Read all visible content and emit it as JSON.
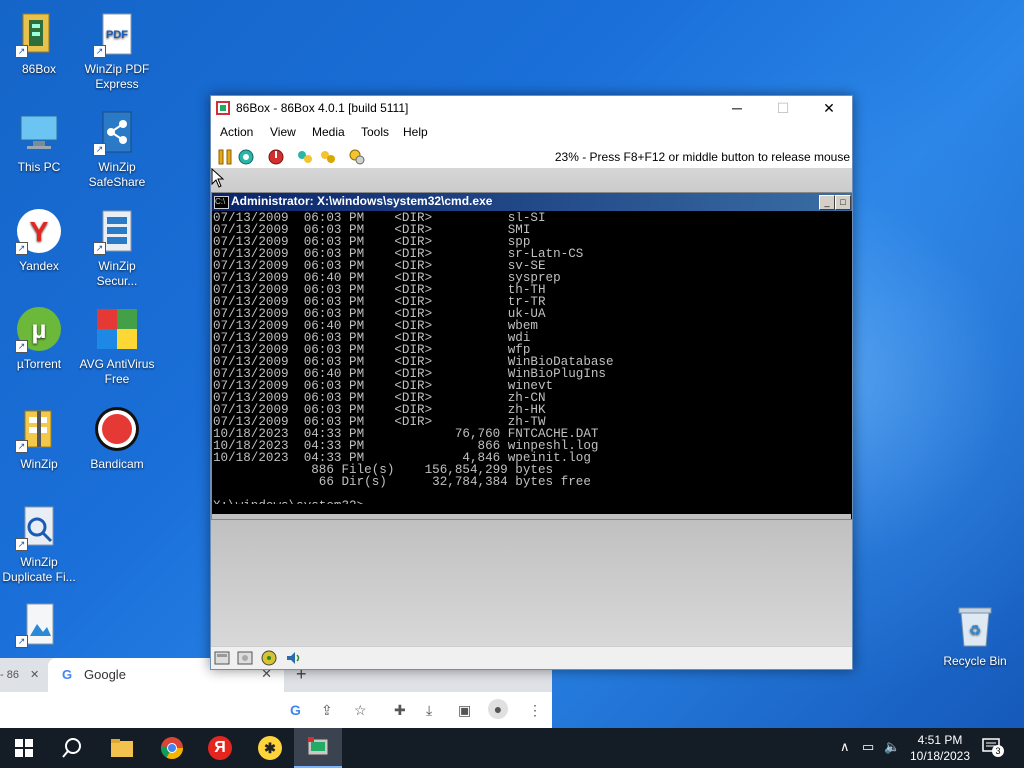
{
  "desktop": {
    "icons": [
      {
        "label": "86Box"
      },
      {
        "label": "WinZip PDF Express"
      },
      {
        "label": "This PC"
      },
      {
        "label": "WinZip SafeShare"
      },
      {
        "label": "Yandex"
      },
      {
        "label": "WinZip Secur..."
      },
      {
        "label": "µTorrent"
      },
      {
        "label": "AVG AntiVirus Free"
      },
      {
        "label": "WinZip"
      },
      {
        "label": "Bandicam"
      },
      {
        "label": "WinZip Duplicate Fi..."
      }
    ],
    "recycle_bin": "Recycle Bin"
  },
  "box86": {
    "title": "86Box - 86Box 4.0.1 [build 5111]",
    "menu": [
      "Action",
      "View",
      "Media",
      "Tools",
      "Help"
    ],
    "status_text": "23% - Press F8+F12 or middle button to release mouse"
  },
  "cmd": {
    "title": "Administrator: X:\\windows\\system32\\cmd.exe",
    "lines": [
      "07/13/2009  06:03 PM    <DIR>          sl-SI",
      "07/13/2009  06:03 PM    <DIR>          SMI",
      "07/13/2009  06:03 PM    <DIR>          spp",
      "07/13/2009  06:03 PM    <DIR>          sr-Latn-CS",
      "07/13/2009  06:03 PM    <DIR>          sv-SE",
      "07/13/2009  06:40 PM    <DIR>          sysprep",
      "07/13/2009  06:03 PM    <DIR>          th-TH",
      "07/13/2009  06:03 PM    <DIR>          tr-TR",
      "07/13/2009  06:03 PM    <DIR>          uk-UA",
      "07/13/2009  06:40 PM    <DIR>          wbem",
      "07/13/2009  06:03 PM    <DIR>          wdi",
      "07/13/2009  06:03 PM    <DIR>          wfp",
      "07/13/2009  06:03 PM    <DIR>          WinBioDatabase",
      "07/13/2009  06:40 PM    <DIR>          WinBioPlugIns",
      "07/13/2009  06:03 PM    <DIR>          winevt",
      "07/13/2009  06:03 PM    <DIR>          zh-CN",
      "07/13/2009  06:03 PM    <DIR>          zh-HK",
      "07/13/2009  06:03 PM    <DIR>          zh-TW",
      "10/18/2023  04:33 PM            76,760 FNTCACHE.DAT",
      "10/18/2023  04:33 PM               866 winpeshl.log",
      "10/18/2023  04:33 PM             4,846 wpeinit.log",
      "             886 File(s)    156,854,299 bytes",
      "              66 Dir(s)      32,784,384 bytes free",
      "",
      "X:\\windows\\system32>"
    ]
  },
  "chrome": {
    "tab_left_fragment": "- 86",
    "tab_title": "Google"
  },
  "taskbar": {
    "clock_time": "4:51 PM",
    "clock_date": "10/18/2023",
    "notification_count": "3"
  }
}
